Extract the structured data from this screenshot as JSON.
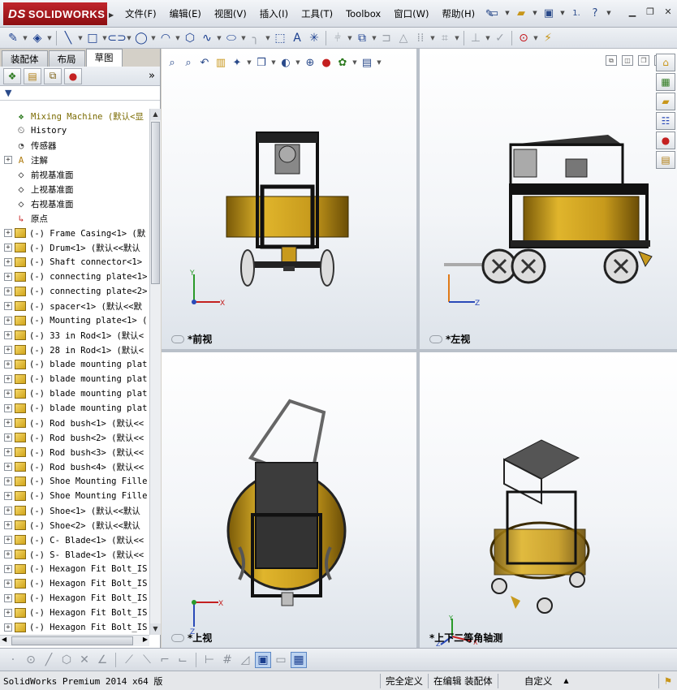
{
  "app": {
    "logo_text": "SOLIDWORKS",
    "logo_prefix": "DS"
  },
  "menu": [
    "文件(F)",
    "编辑(E)",
    "视图(V)",
    "插入(I)",
    "工具(T)",
    "Toolbox",
    "窗口(W)",
    "帮助(H)"
  ],
  "quick": {
    "help_label": "?",
    "number": "1."
  },
  "tabs": [
    "装配体",
    "布局",
    "草图"
  ],
  "active_tab": 2,
  "tree": [
    {
      "label": "Mixing Machine  (默认<显",
      "icon": "assembly",
      "exp": false,
      "root": true
    },
    {
      "label": "History",
      "icon": "history",
      "exp": false
    },
    {
      "label": "传感器",
      "icon": "sensor",
      "exp": false
    },
    {
      "label": "注解",
      "icon": "annotation",
      "exp": true
    },
    {
      "label": "前视基准面",
      "icon": "plane",
      "exp": false
    },
    {
      "label": "上视基准面",
      "icon": "plane",
      "exp": false
    },
    {
      "label": "右视基准面",
      "icon": "plane",
      "exp": false
    },
    {
      "label": "原点",
      "icon": "origin",
      "exp": false
    },
    {
      "label": "(-) Frame Casing<1> (默",
      "icon": "part",
      "exp": true
    },
    {
      "label": "(-) Drum<1> (默认<<默认",
      "icon": "part",
      "exp": true
    },
    {
      "label": "(-) Shaft connector<1>",
      "icon": "part",
      "exp": true
    },
    {
      "label": "(-) connecting plate<1>",
      "icon": "part",
      "exp": true
    },
    {
      "label": "(-) connecting plate<2>",
      "icon": "part",
      "exp": true
    },
    {
      "label": "(-) spacer<1> (默认<<默",
      "icon": "part",
      "exp": true
    },
    {
      "label": "(-) Mounting plate<1> (",
      "icon": "part",
      "exp": true
    },
    {
      "label": "(-) 33 in Rod<1> (默认<",
      "icon": "part",
      "exp": true
    },
    {
      "label": "(-) 28 in Rod<1> (默认<",
      "icon": "part",
      "exp": true
    },
    {
      "label": "(-) blade mounting plat",
      "icon": "part",
      "exp": true
    },
    {
      "label": "(-) blade mounting plat",
      "icon": "part",
      "exp": true
    },
    {
      "label": "(-) blade mounting plat",
      "icon": "part",
      "exp": true
    },
    {
      "label": "(-) blade mounting plat",
      "icon": "part",
      "exp": true
    },
    {
      "label": "(-) Rod bush<1> (默认<<",
      "icon": "part",
      "exp": true
    },
    {
      "label": "(-) Rod bush<2> (默认<<",
      "icon": "part",
      "exp": true
    },
    {
      "label": "(-) Rod bush<3> (默认<<",
      "icon": "part",
      "exp": true
    },
    {
      "label": "(-) Rod bush<4> (默认<<",
      "icon": "part",
      "exp": true
    },
    {
      "label": "(-) Shoe Mounting Fille",
      "icon": "part",
      "exp": true
    },
    {
      "label": "(-) Shoe Mounting Fille",
      "icon": "part",
      "exp": true
    },
    {
      "label": "(-) Shoe<1> (默认<<默认",
      "icon": "part",
      "exp": true
    },
    {
      "label": "(-) Shoe<2> (默认<<默认",
      "icon": "part",
      "exp": true
    },
    {
      "label": "(-) C- Blade<1> (默认<<",
      "icon": "part",
      "exp": true
    },
    {
      "label": "(-) S- Blade<1> (默认<<",
      "icon": "part",
      "exp": true
    },
    {
      "label": "(-) Hexagon Fit Bolt_IS",
      "icon": "part",
      "exp": true
    },
    {
      "label": "(-) Hexagon Fit Bolt_IS",
      "icon": "part",
      "exp": true
    },
    {
      "label": "(-) Hexagon Fit Bolt_IS",
      "icon": "part",
      "exp": true
    },
    {
      "label": "(-) Hexagon Fit Bolt_IS",
      "icon": "part",
      "exp": true
    },
    {
      "label": "(-) Hexagon Fit Bolt_IS",
      "icon": "part",
      "exp": true
    }
  ],
  "views": {
    "front": "*前视",
    "left": "*左视",
    "top": "*上视",
    "iso": "*上下二等角轴测"
  },
  "axes": {
    "x": "X",
    "y": "Y",
    "z": "Z"
  },
  "status": {
    "app": "SolidWorks Premium 2014 x64 版",
    "defined": "完全定义",
    "editing": "在编辑 装配体",
    "custom": "自定义"
  },
  "colors": {
    "brand": "#b01c22",
    "drum": "#c89a1e",
    "frame": "#222222",
    "view_bg": "#e3e8ee"
  }
}
